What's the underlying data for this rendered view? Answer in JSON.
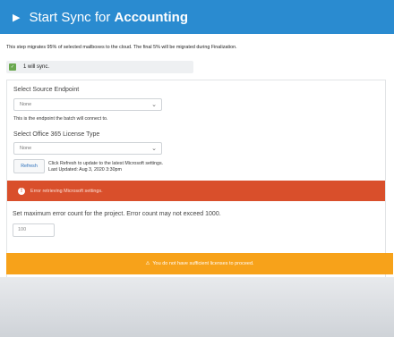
{
  "header": {
    "prefix": "Start Sync for ",
    "project": "Accounting"
  },
  "intro_text": "This step migrates 95% of selected mailboxes to the cloud. The final 5% will be migrated during Finalization.",
  "sync_status": {
    "count_text": "1 will sync."
  },
  "source_endpoint": {
    "label": "Select Source Endpoint",
    "value": "None",
    "hint": "This is the endpoint the batch will connect to."
  },
  "license_type": {
    "label": "Select Office 365 License Type",
    "value": "None"
  },
  "refresh": {
    "button_label": "Refresh",
    "note_line1": "Click Refresh to update to the latest Microsoft settings.",
    "note_line2": "Last Updated: Aug 3, 2020 3:30pm"
  },
  "error": {
    "message": "Error retrieving Microsoft settings."
  },
  "error_count": {
    "label": "Set maximum error count for the project. Error count may not exceed 1000.",
    "value": "100"
  },
  "warning": {
    "message": "You do not have sufficient licenses to proceed."
  },
  "colors": {
    "header_bg": "#2a8bd0",
    "error_bg": "#d94f2b",
    "warning_bg": "#f7a21a",
    "success": "#6aa84f"
  },
  "icons": {
    "header": "play-icon",
    "sync": "check-icon",
    "error": "alert-circle-icon",
    "warning": "warning-triangle-icon"
  }
}
